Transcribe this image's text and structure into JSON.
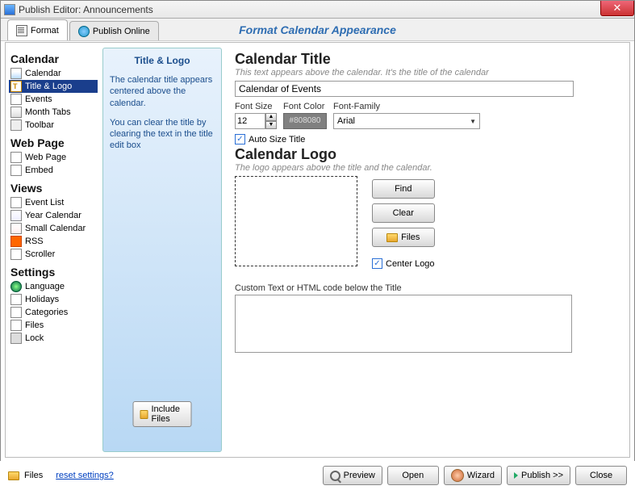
{
  "window": {
    "title": "Publish Editor: Announcements"
  },
  "tabs": {
    "format": "Format",
    "publish": "Publish Online"
  },
  "page_header": "Format Calendar Appearance",
  "sidebar": {
    "g1_title": "Calendar",
    "g1": {
      "i0": "Calendar",
      "i1": "Title & Logo",
      "i2": "Events",
      "i3": "Month Tabs",
      "i4": "Toolbar"
    },
    "g2_title": "Web Page",
    "g2": {
      "i0": "Web Page",
      "i1": "Embed"
    },
    "g3_title": "Views",
    "g3": {
      "i0": "Event List",
      "i1": "Year Calendar",
      "i2": "Small Calendar",
      "i3": "RSS",
      "i4": "Scroller"
    },
    "g4_title": "Settings",
    "g4": {
      "i0": "Language",
      "i1": "Holidays",
      "i2": "Categories",
      "i3": "Files",
      "i4": "Lock"
    }
  },
  "info": {
    "title": "Title & Logo",
    "p1": "The calendar title appears centered above the calendar.",
    "p2": "You can clear the title by clearing the text in the title edit box",
    "include_btn": "Include Files"
  },
  "main": {
    "title_heading": "Calendar Title",
    "title_sub": "This text appears above the calendar.  It's the title of the calendar",
    "title_value": "Calendar of Events",
    "fontsize_label": "Font Size",
    "fontsize_value": "12",
    "fontcolor_label": "Font Color",
    "fontcolor_value": "#808080",
    "fontfamily_label": "Font-Family",
    "fontfamily_value": "Arial",
    "autosize_label": "Auto Size Title",
    "logo_heading": "Calendar Logo",
    "logo_sub": "The logo appears above the title and the calendar.",
    "find_btn": "Find",
    "clear_btn": "Clear",
    "files_btn": "Files",
    "centerlogo_label": "Center Logo",
    "custom_label": "Custom Text or HTML code below the Title"
  },
  "footer": {
    "files": "Files",
    "reset": "reset settings?",
    "preview": "Preview",
    "open": "Open",
    "wizard": "Wizard",
    "publish": "Publish >>",
    "close": "Close"
  }
}
